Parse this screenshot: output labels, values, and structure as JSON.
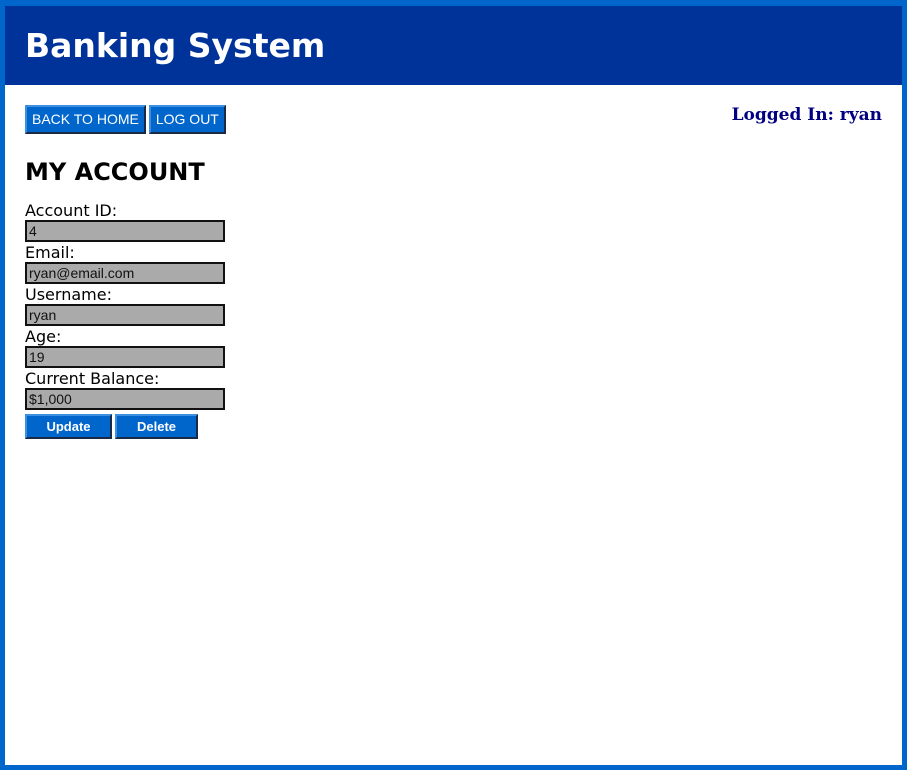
{
  "header": {
    "title": "Banking System"
  },
  "nav": {
    "back_label": "BACK TO HOME",
    "logout_label": "LOG OUT"
  },
  "session": {
    "logged_in_text": "Logged In: ryan"
  },
  "page": {
    "title": "MY ACCOUNT"
  },
  "form": {
    "fields": [
      {
        "label": "Account ID:",
        "value": "4"
      },
      {
        "label": "Email:",
        "value": "ryan@email.com"
      },
      {
        "label": "Username:",
        "value": "ryan"
      },
      {
        "label": "Age:",
        "value": "19"
      },
      {
        "label": "Current Balance:",
        "value": "$1,000"
      }
    ],
    "update_label": "Update",
    "delete_label": "Delete"
  },
  "colors": {
    "frame_border": "#0066cc",
    "header_bg": "#003399",
    "button_bg": "#0066cc",
    "input_bg": "#aaaaaa",
    "logged_in_text": "#000080"
  }
}
